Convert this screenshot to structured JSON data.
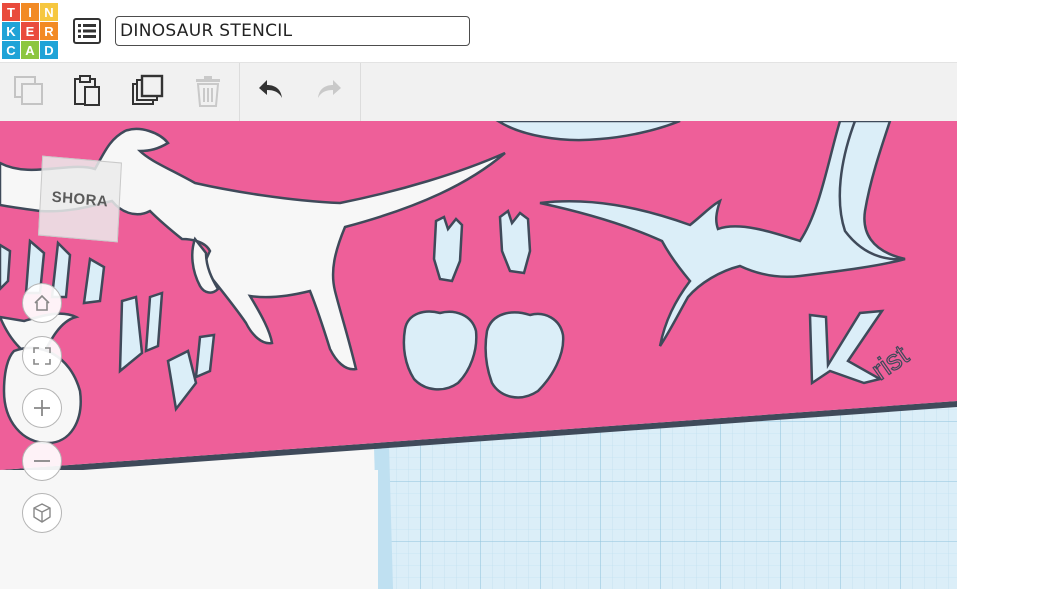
{
  "logo": {
    "letters": [
      "T",
      "I",
      "N",
      "K",
      "E",
      "R",
      "C",
      "A",
      "D"
    ],
    "colors": [
      "#e94b3c",
      "#f28a24",
      "#f6c73f",
      "#1fa3d7",
      "#e94b3c",
      "#f28a24",
      "#1fa3d7",
      "#8cc63f",
      "#1fa3d7"
    ]
  },
  "header": {
    "design_title": "DINOSAUR STENCIL"
  },
  "toolbar": {
    "icons": [
      "copy-icon",
      "paste-icon",
      "duplicate-icon",
      "delete-icon",
      "undo-icon",
      "redo-icon"
    ]
  },
  "viewcube": {
    "face_label": "SHORA"
  },
  "stencil": {
    "signature": "rist",
    "signature_initial": "K",
    "color": "#ee5f99",
    "outline_color": "#3f4a5a"
  },
  "nav": {
    "icons": [
      "home-icon",
      "fit-view-icon",
      "zoom-in-icon",
      "zoom-out-icon",
      "perspective-icon"
    ]
  },
  "colors": {
    "grid": "#dbeef8",
    "grid_line": "#a9d2e6",
    "accent": "#ee5f99"
  }
}
